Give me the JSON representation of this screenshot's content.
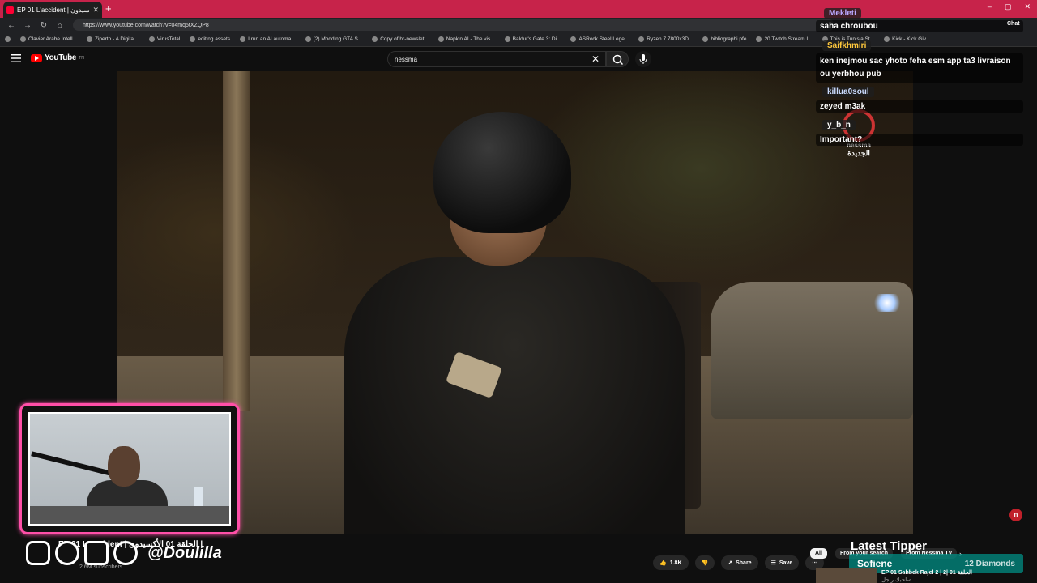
{
  "browser": {
    "tab_title": "EP 01 L'accident | الحلقة 01 الأكسيدون",
    "url": "https://www.youtube.com/watch?v=04mq5tXZQP8",
    "bookmarks": [
      "Clavier Arabe Intell...",
      "Ziperto - A Digital...",
      "VirusTotal",
      "editing assets",
      "I run an AI automa...",
      "(2) Modding GTA S...",
      "Copy of hr-newslet...",
      "Napkin AI - The vis...",
      "Baldur's Gate 3: Di...",
      "ASRock Steel Lege...",
      "Ryzen 7 7800x3D...",
      "bibliographi pfe",
      "20 Twitch Stream I...",
      "This is Tunisia St...",
      "Kick - Kick Giv..."
    ],
    "window_controls": [
      "–",
      "▢",
      "✕"
    ],
    "new_tab": "+"
  },
  "youtube": {
    "logo_text": "YouTube",
    "logo_sup": "TN",
    "search_value": "nessma",
    "channel_watermark": {
      "line1": "nessma",
      "line2": "الجديدة"
    },
    "video_title": "EP 01 L'accident | الحلقة 01 الأكسيدون |",
    "subscribers": "2.6M subscribers",
    "actions": {
      "likes": "1.8K",
      "share": "Share",
      "save": "Save",
      "more": "⋯"
    },
    "chips": [
      "All",
      "From your search",
      "From Nessma TV"
    ],
    "recommended": {
      "title": "EP 01 Sahbek Rajel 2 | 2| 01 الحلقة",
      "subtitle": "صاحبك راجل"
    }
  },
  "chat": [
    {
      "user": "Mekleti",
      "text": "saha chroubou"
    },
    {
      "user": "Saifkhmiri",
      "text": "ken inejmou sac yhoto feha esm app ta3 livraison ou yerbhou pub"
    },
    {
      "user": "killua0soul",
      "text": "zeyed m3ak"
    },
    {
      "user": "y_b_n",
      "text": "Important?"
    }
  ],
  "chat_label": "Chat",
  "overlay": {
    "handle": "@Doulilla",
    "latest_tipper_title": "Latest Tipper",
    "latest_tipper_name": "Sofiene",
    "latest_tipper_amount": "12 Diamonds"
  },
  "colors": {
    "tab_strip": "#c7234a",
    "webcam_border": "#ff4fa8",
    "yt_red": "#ff0000",
    "tipper_box": "#00968c"
  }
}
